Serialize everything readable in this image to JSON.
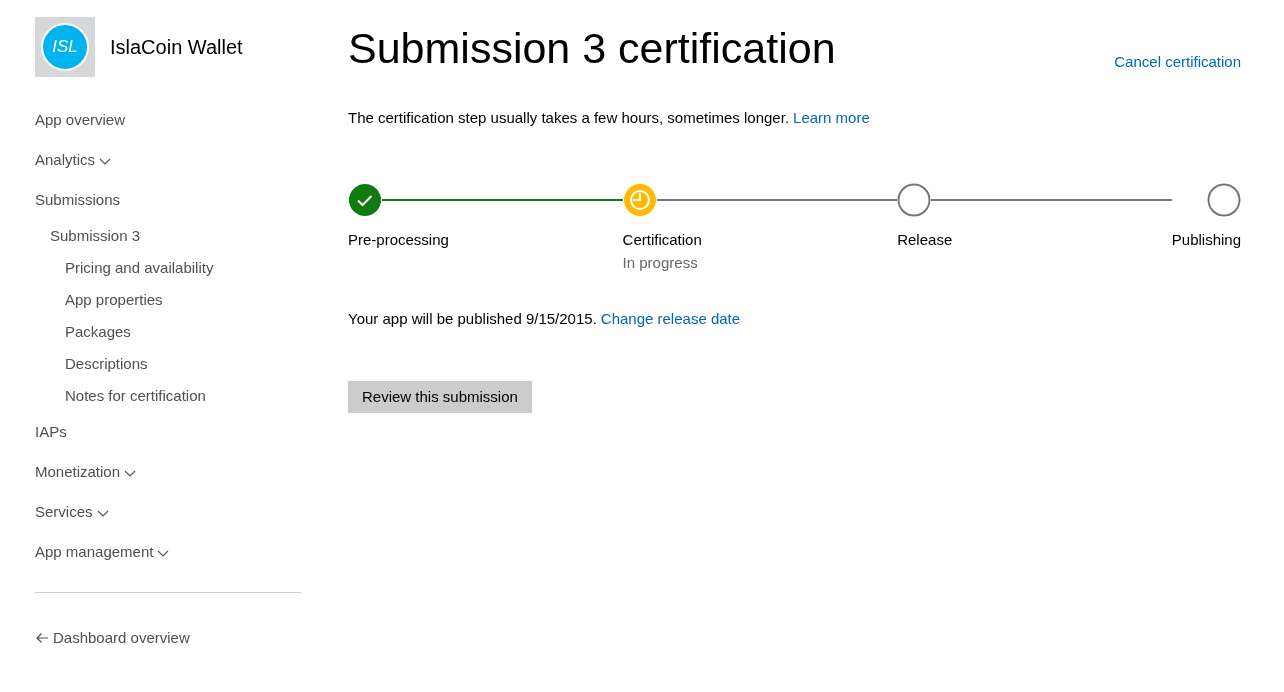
{
  "app": {
    "logo_text": "ISL",
    "name": "IslaCoin Wallet"
  },
  "sidebar": {
    "items": [
      {
        "label": "App overview",
        "kind": "link"
      },
      {
        "label": "Analytics",
        "kind": "menu"
      },
      {
        "label": "Submissions",
        "kind": "link",
        "children": [
          {
            "label": "Submission 3",
            "kind": "link",
            "children": [
              {
                "label": "Pricing and availability",
                "kind": "link"
              },
              {
                "label": "App properties",
                "kind": "link"
              },
              {
                "label": "Packages",
                "kind": "link"
              },
              {
                "label": "Descriptions",
                "kind": "link"
              },
              {
                "label": "Notes for certification",
                "kind": "link"
              }
            ]
          }
        ]
      },
      {
        "label": "IAPs",
        "kind": "link"
      },
      {
        "label": "Monetization",
        "kind": "menu"
      },
      {
        "label": "Services",
        "kind": "menu"
      },
      {
        "label": "App management",
        "kind": "menu"
      }
    ],
    "back_link": "Dashboard overview"
  },
  "page": {
    "title": "Submission 3 certification",
    "cancel_link": "Cancel certification",
    "intro": "The certification step usually takes a few hours, sometimes longer.",
    "intro_link": "Learn more",
    "steps": [
      {
        "label": "Pre-processing",
        "kind": "done"
      },
      {
        "label": "Certification",
        "kind": "active",
        "sublabel": "In progress"
      },
      {
        "label": "Release",
        "kind": "pending"
      },
      {
        "label": "Publishing",
        "kind": "pending"
      }
    ],
    "publish_note": "Your app will be published 9/15/2015.",
    "publish_link": "Change release date",
    "review_button": "Review this submission"
  }
}
